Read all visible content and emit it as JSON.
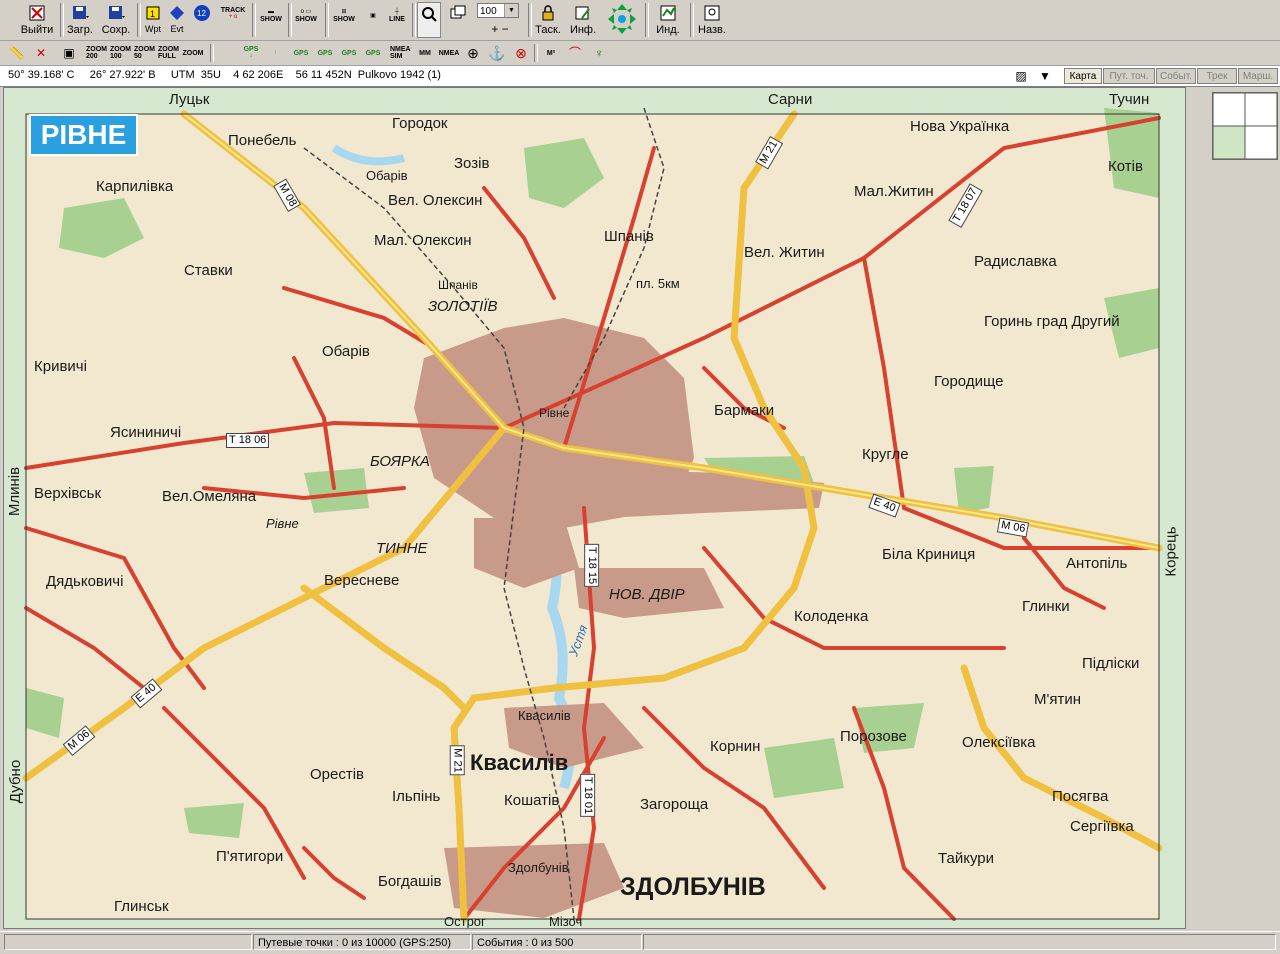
{
  "toolbar": {
    "exit": "Выйти",
    "load": "Загр.",
    "save": "Сохр.",
    "wpt": "Wpt",
    "evt": "Evt",
    "zoom_value": "100",
    "drag": "Таск.",
    "info": "Инф.",
    "ind": "Инд.",
    "names": "Назв.",
    "small_labels": {
      "track": "TRACK",
      "show": "SHOW",
      "line": "LINE",
      "zoom200": "ZOOM 200",
      "zoom100": "ZOOM 100",
      "zoom50": "ZOOM 50",
      "zoomfull": "ZOOM FULL",
      "zoom": "ZOOM",
      "gps": "GPS",
      "nmea_sim": "NMEA SIM",
      "mm": "MM",
      "nmea": "NMEA",
      "m2": "M²"
    }
  },
  "coords": {
    "lat": "50° 39.168' С",
    "lon": "26° 27.922' В",
    "utm": "UTM  35U",
    "easting": "4 62 206E",
    "northing": "56 11 452N",
    "datum": "Pulkovo 1942 (1)"
  },
  "view_tabs": [
    "Карта",
    "Пут. точ.",
    "Событ.",
    "Трек",
    "Марш."
  ],
  "map": {
    "title": "РІВНЕ",
    "edges": {
      "top_left": "Луцьк",
      "top_mid": "Сарни",
      "top_right": "Тучин",
      "left": "Млинів",
      "left_bottom": "Дубно",
      "right": "Корець",
      "bottom_mid": "Острог",
      "bottom_mid2": "Мізоч"
    },
    "places": [
      "Понебель",
      "Городок",
      "Зозів",
      "Обарів",
      "Вел. Олексин",
      "Мал. Олексин",
      "Шпанів",
      "Шпанів",
      "пл. 5км",
      "Нова Українка",
      "Котів",
      "Мал.Житин",
      "Вел. Житин",
      "Радиславка",
      "Карпилівка",
      "Ставки",
      "ЗОЛОТІЇВ",
      "Обарів",
      "Горинь град Другий",
      "Кривичі",
      "Рівне",
      "Бармаки",
      "Городище",
      "Ясининичі",
      "БОЯРКА",
      "Круглe",
      "Верхівськ",
      "Вел.Омеляна",
      "Рівне",
      "ТИННЕ",
      "Біла Криниця",
      "Антопіль",
      "Дядьковичі",
      "Вересневе",
      "НОВ. ДВІР",
      "Колоденка",
      "Глинки",
      "Підліски",
      "М'ятин",
      "Квасилів",
      "Корнин",
      "Порозове",
      "Олексіївка",
      "Квасилів",
      "Орестів",
      "Ільпінь",
      "Кошатів",
      "Загороща",
      "Посягва",
      "Сергіївка",
      "П'ятигори",
      "Тайкури",
      "Богдашів",
      "Здолбунів",
      "ЗДОЛБУНІВ",
      "Глинськ",
      "Устя"
    ],
    "roads": [
      "М 08",
      "М 21",
      "Т 18 07",
      "Т 18 06",
      "Е 40",
      "М 06",
      "Т 18 15",
      "Е 40",
      "М 06",
      "М 21",
      "Т 18 01"
    ]
  },
  "status": {
    "waypoints": "Путевые точки : 0 из 10000  (GPS:250)",
    "events": "События : 0 из 500"
  },
  "colors": {
    "land": "#f2e8d0",
    "forest": "#a8d090",
    "city": "#c89a8a",
    "major_road": "#f0c040",
    "road": "#d84030",
    "water": "#a8d8f0"
  }
}
